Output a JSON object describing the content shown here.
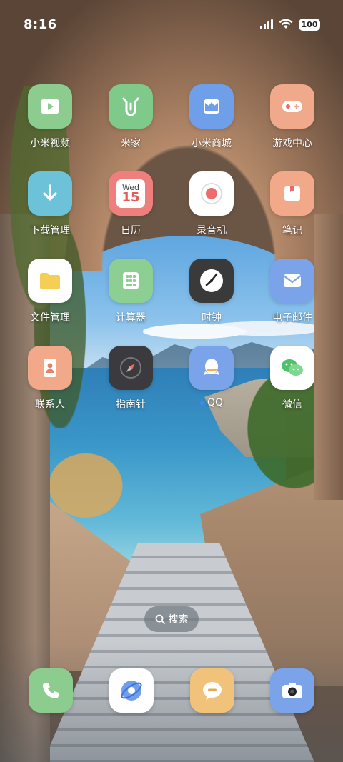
{
  "status_bar": {
    "time": "8:16",
    "battery": "100",
    "icons": [
      "signal-icon",
      "wifi-icon",
      "battery-icon"
    ]
  },
  "apps": [
    {
      "label": "小米视频",
      "icon": "play-icon",
      "color": "#8ccc8e"
    },
    {
      "label": "米家",
      "icon": "mijia-icon",
      "color": "#7fc98a"
    },
    {
      "label": "小米商城",
      "icon": "store-icon",
      "color": "#6f9fe8"
    },
    {
      "label": "游戏中心",
      "icon": "gamepad-icon",
      "color": "#f0a98a"
    },
    {
      "label": "下载管理",
      "icon": "download-icon",
      "color": "#6cc3d9"
    },
    {
      "label": "日历",
      "icon": "calendar-icon",
      "color": "#ef7f7c",
      "calendar_day": "Wed",
      "calendar_date": "15"
    },
    {
      "label": "录音机",
      "icon": "record-icon",
      "color": "#ffffff"
    },
    {
      "label": "笔记",
      "icon": "notes-icon",
      "color": "#f2a98a"
    },
    {
      "label": "文件管理",
      "icon": "folder-icon",
      "color": "#ffffff"
    },
    {
      "label": "计算器",
      "icon": "calculator-icon",
      "color": "#8dcf92"
    },
    {
      "label": "时钟",
      "icon": "clock-icon",
      "color": "#3a3a3a"
    },
    {
      "label": "电子邮件",
      "icon": "mail-icon",
      "color": "#7aa3ea"
    },
    {
      "label": "联系人",
      "icon": "contacts-icon",
      "color": "#f2a98a"
    },
    {
      "label": "指南针",
      "icon": "compass-icon",
      "color": "#3b3b3f"
    },
    {
      "label": "QQ",
      "icon": "qq-icon",
      "color": "#7aa3ea"
    },
    {
      "label": "微信",
      "icon": "wechat-icon",
      "color": "#ffffff"
    }
  ],
  "search": {
    "label": "搜索",
    "icon": "search-icon"
  },
  "dock": [
    {
      "name": "phone",
      "icon": "phone-icon",
      "color": "#8ccc8e"
    },
    {
      "name": "browser",
      "icon": "browser-icon",
      "color": "#ffffff"
    },
    {
      "name": "messages",
      "icon": "message-icon",
      "color": "#f1c27a"
    },
    {
      "name": "camera",
      "icon": "camera-icon",
      "color": "#7aa3ea"
    }
  ]
}
